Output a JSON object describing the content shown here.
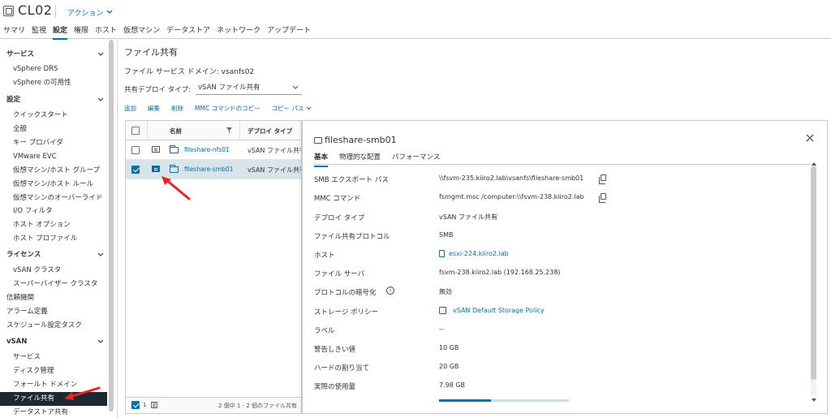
{
  "header": {
    "title": "CL02",
    "actions_label": "アクション"
  },
  "tabs": [
    {
      "label": "サマリ"
    },
    {
      "label": "監視"
    },
    {
      "label": "設定"
    },
    {
      "label": "権限"
    },
    {
      "label": "ホスト"
    },
    {
      "label": "仮想マシン"
    },
    {
      "label": "データストア"
    },
    {
      "label": "ネットワーク"
    },
    {
      "label": "アップデート"
    }
  ],
  "active_tab": "設定",
  "sidebar": {
    "groups": {
      "services": "サービス",
      "settings": "設定",
      "license": "ライセンス",
      "vsan": "vSAN"
    },
    "items": {
      "drs": "vSphere DRS",
      "ha": "vSphere の可用性",
      "quickstart": "クイックスタート",
      "general": "全般",
      "key_provider": "キー プロバイダ",
      "evc": "VMware EVC",
      "vm_host_groups": "仮想マシン/ホスト グループ",
      "vm_host_rules": "仮想マシン/ホスト ルール",
      "vm_overrides": "仮想マシンのオーバーライド",
      "io_filter": "I/O フィルタ",
      "host_options": "ホスト オプション",
      "host_profile": "ホスト プロファイル",
      "vsan_cluster": "vSAN クラスタ",
      "supervisor_cluster": "スーパーバイザー クラスタ",
      "trust_authority": "信頼機関",
      "alarm_definitions": "アラーム定義",
      "scheduled_tasks": "スケジュール設定タスク",
      "vsan_services": "サービス",
      "disk_management": "ディスク管理",
      "fault_domains": "フォールト ドメイン",
      "file_shares": "ファイル共有",
      "datastore_sharing": "データストア共有"
    }
  },
  "main": {
    "title": "ファイル共有",
    "domain_line": "ファイル サービス ドメイン: vsanfs02",
    "deploy_type_label": "共有デプロイ タイプ:",
    "deploy_type_value": "vSAN ファイル共有",
    "toolbar": {
      "add": "追加",
      "edit": "編集",
      "delete": "削除",
      "copy_mmc": "MMC コマンドのコピー",
      "copy_path": "コピー パス"
    }
  },
  "table": {
    "columns": {
      "name": "名前",
      "deploy_type": "デプロイ タイプ"
    },
    "rows": [
      {
        "name": "fileshare-nfs01",
        "type": "vSAN ファイル共有",
        "selected": false
      },
      {
        "name": "fileshare-smb01",
        "type": "vSAN ファイル共有",
        "selected": true
      }
    ],
    "footer_selected_count": "1",
    "footer_text": "2 個中 1 - 2 個のファイル共有"
  },
  "detail": {
    "title": "fileshare-smb01",
    "tabs": [
      {
        "label": "基本"
      },
      {
        "label": "物理的な配置"
      },
      {
        "label": "パフォーマンス"
      }
    ],
    "props": {
      "smb_path_label": "SMB エクスポート パス",
      "smb_path_value": "\\\\fsvm-235.kiiro2.lab\\vsanfs\\fileshare-smb01",
      "mmc_label": "MMC コマンド",
      "mmc_value": "fsmgmt.msc /computer:\\\\fsvm-238.kiiro2.lab",
      "deploy_label": "デプロイ タイプ",
      "deploy_value": "vSAN ファイル共有",
      "protocol_label": "ファイル共有プロトコル",
      "protocol_value": "SMB",
      "host_label": "ホスト",
      "host_value": "esxi-224.kiiro2.lab",
      "file_server_label": "ファイル サーバ",
      "file_server_value": "fsvm-238.kiiro2.lab (192.168.25.238)",
      "encryption_label": "プロトコルの暗号化",
      "encryption_value": "無効",
      "storage_policy_label": "ストレージ ポリシー",
      "storage_policy_value": "vSAN Default Storage Policy",
      "label_label": "ラベル",
      "label_value": "--",
      "warning_label": "警告しきい値",
      "warning_value": "10 GB",
      "hard_quota_label": "ハードの割り当て",
      "hard_quota_value": "20 GB",
      "actual_usage_label": "実際の使用量",
      "actual_usage_value": "7.98 GB",
      "actual_usage_fraction": 0.4
    }
  },
  "colors": {
    "accent": "#0072a3",
    "selected_nav_bg": "#1b2a32",
    "annotation_arrow": "#e8261e"
  }
}
